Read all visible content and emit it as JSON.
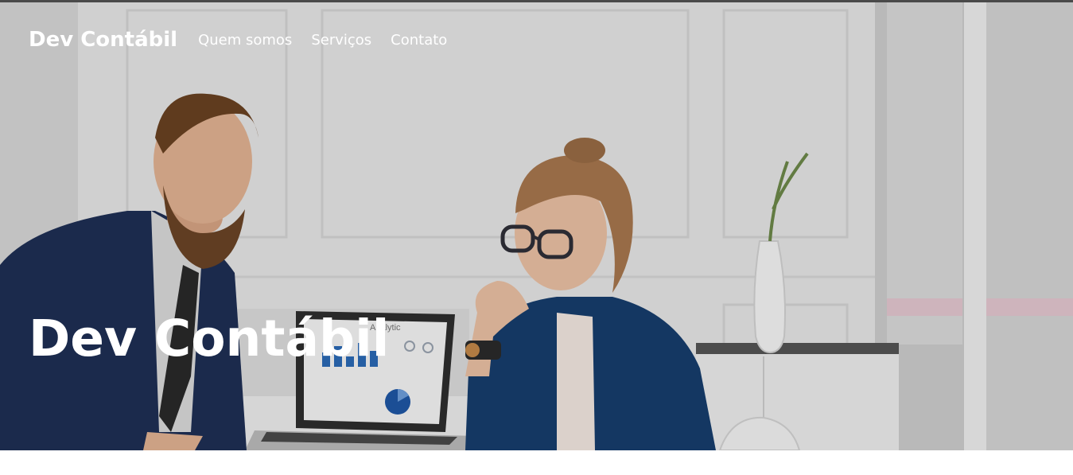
{
  "navbar": {
    "brand": "Dev Contábil",
    "links": [
      "Quem somos",
      "Serviços",
      "Contato"
    ]
  },
  "hero": {
    "title": "Dev Contábil",
    "laptop_screen_text": "Analytic"
  },
  "colors": {
    "nav_text": "#ffffff",
    "suit_navy": "#1f2f55",
    "blazer_blue": "#173e6e",
    "wall": "#e6e6e6"
  }
}
